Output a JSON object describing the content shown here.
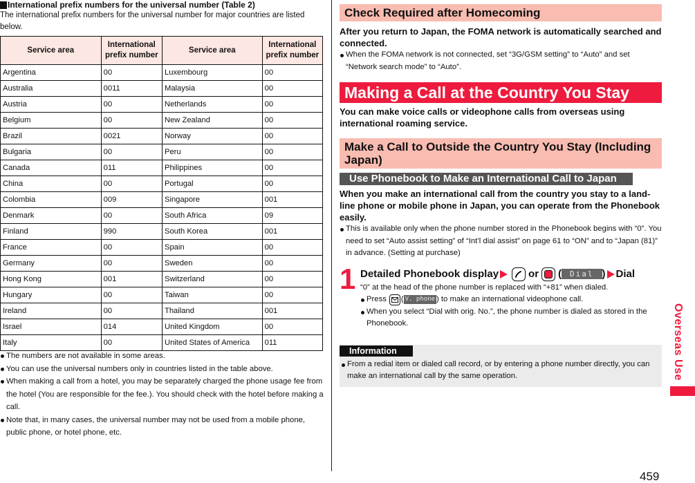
{
  "left": {
    "table_heading": "International prefix numbers for the universal number (Table 2)",
    "intro": "The international prefix numbers for the universal number for major countries are listed below.",
    "table": {
      "headers": [
        "Service area",
        "International prefix number",
        "Service area",
        "International prefix number"
      ],
      "rows": [
        [
          "Argentina",
          "00",
          "Luxembourg",
          "00"
        ],
        [
          "Australia",
          "0011",
          "Malaysia",
          "00"
        ],
        [
          "Austria",
          "00",
          "Netherlands",
          "00"
        ],
        [
          "Belgium",
          "00",
          "New Zealand",
          "00"
        ],
        [
          "Brazil",
          "0021",
          "Norway",
          "00"
        ],
        [
          "Bulgaria",
          "00",
          "Peru",
          "00"
        ],
        [
          "Canada",
          "011",
          "Philippines",
          "00"
        ],
        [
          "China",
          "00",
          "Portugal",
          "00"
        ],
        [
          "Colombia",
          "009",
          "Singapore",
          "001"
        ],
        [
          "Denmark",
          "00",
          "South Africa",
          "09"
        ],
        [
          "Finland",
          "990",
          "South Korea",
          "001"
        ],
        [
          "France",
          "00",
          "Spain",
          "00"
        ],
        [
          "Germany",
          "00",
          "Sweden",
          "00"
        ],
        [
          "Hong Kong",
          "001",
          "Switzerland",
          "00"
        ],
        [
          "Hungary",
          "00",
          "Taiwan",
          "00"
        ],
        [
          "Ireland",
          "00",
          "Thailand",
          "001"
        ],
        [
          "Israel",
          "014",
          "United Kingdom",
          "00"
        ],
        [
          "Italy",
          "00",
          "United States of America",
          "011"
        ]
      ]
    },
    "notes": [
      "The numbers are not available in some areas.",
      "You can use the universal numbers only in countries listed in the table above.",
      "When making a call from a hotel, you may be separately charged the phone usage fee from the hotel (You are responsible for the fee.). You should check with the hotel before making a call.",
      "Note that, in many cases, the universal number may not be used from a mobile phone, public phone, or hotel phone, etc."
    ]
  },
  "right": {
    "check_heading": "Check Required after Homecoming",
    "check_lead": "After you return to Japan, the FOMA network is automatically searched and connected.",
    "check_note": "When the FOMA network is not connected, set “3G/GSM setting” to “Auto” and set “Network search mode” to “Auto”.",
    "making_heading": "Making a Call at the Country You Stay",
    "making_lead": "You can make voice calls or videophone calls from overseas using international roaming service.",
    "outside_heading": "Make a Call to Outside the Country You Stay (Including Japan)",
    "phonebook_heading": "Use Phonebook to Make an International Call to Japan",
    "phonebook_lead": "When you make an international call from the country you stay to a land-line phone or mobile phone in Japan, you can operate from the Phonebook easily.",
    "phonebook_note": "This is available only when the phone number stored in the Phonebook begins with “0”. You need to set “Auto assist setting” of “Int’l dial assist” on page 61 to “ON” and to “Japan (81)” in advance. (Setting at purchase)",
    "step": {
      "number": "1",
      "title_part1": "Detailed Phonebook display",
      "or": "or",
      "paren_open": "(",
      "softkey_dial": "Dial",
      "paren_close": ")",
      "title_end": "Dial",
      "desc": "“0” at the head of the phone number is replaced with “+81” when dialed.",
      "bullet1_pre": "Press",
      "bullet1_softkey": "V. phone",
      "bullet1_post": ") to make an international videophone call.",
      "bullet2": "When you select “Dial with orig. No.”, the phone number is dialed as stored in the Phonebook."
    },
    "info": {
      "tag": "Information",
      "text": "From a redial item or dialed call record, or by entering a phone number directly, you can make an international call by the same operation."
    }
  },
  "side_tab": "Overseas Use",
  "page_number": "459",
  "colors": {
    "accent_red": "#ee1b3e",
    "heading_pink": "#f9bcb1",
    "table_header_pink": "#fde7e2",
    "sub_heading_gray": "#555555",
    "info_bg": "#ebebeb"
  }
}
